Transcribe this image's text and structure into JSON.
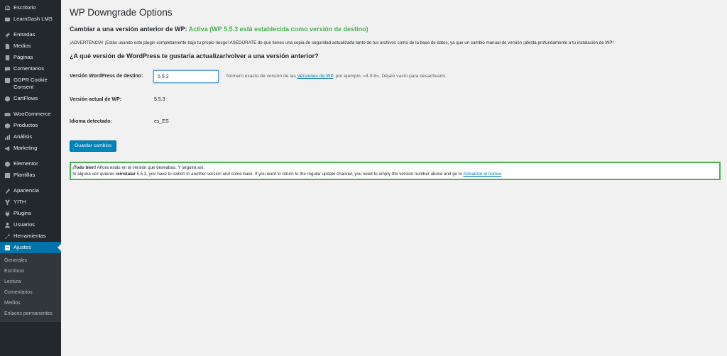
{
  "sidebar": {
    "items": [
      {
        "label": "Escritorio",
        "icon": "dashboard-icon"
      },
      {
        "label": "LearnDash LMS",
        "icon": "learndash-icon"
      },
      {
        "label": "Entradas",
        "icon": "pin-icon"
      },
      {
        "label": "Medios",
        "icon": "media-icon"
      },
      {
        "label": "Páginas",
        "icon": "page-icon"
      },
      {
        "label": "Comentarios",
        "icon": "comment-icon"
      },
      {
        "label": "GDPR Cookie Consent",
        "icon": "gdpr-icon"
      },
      {
        "label": "CartFlows",
        "icon": "cartflows-icon"
      },
      {
        "label": "WooCommerce",
        "icon": "woocommerce-icon"
      },
      {
        "label": "Productos",
        "icon": "products-icon"
      },
      {
        "label": "Análisis",
        "icon": "analytics-icon"
      },
      {
        "label": "Marketing",
        "icon": "marketing-icon"
      },
      {
        "label": "Elementor",
        "icon": "elementor-icon"
      },
      {
        "label": "Plantillas",
        "icon": "templates-icon"
      },
      {
        "label": "Apariencia",
        "icon": "appearance-icon"
      },
      {
        "label": "YITH",
        "icon": "yith-icon"
      },
      {
        "label": "Plugins",
        "icon": "plugins-icon"
      },
      {
        "label": "Usuarios",
        "icon": "users-icon"
      },
      {
        "label": "Herramientas",
        "icon": "tools-icon"
      },
      {
        "label": "Ajustes",
        "icon": "settings-icon"
      }
    ],
    "submenu": [
      "Generales",
      "Escritura",
      "Lectura",
      "Comentarios",
      "Medios",
      "Enlaces permanentes"
    ]
  },
  "main": {
    "title": "WP Downgrade Options",
    "subhead_prefix": "Cambiar a una versión anterior de WP: ",
    "subhead_status": "Activa (WP 5.5.3 está establecida como versión de destino)",
    "warning": "¡ADVERTENCIA! ¡Estás usando este plugin completamente bajo tu propio riesgo! ASEGÚRATE de que tienes una copia de seguridad actualizada tanto de tus archivos como de la base de datos, ya que un cambio manual de versión ¡afecta profundamente a tu instalación de WP!",
    "question": "¿A qué versión de WordPress te gustaría actualizar/volver a una versión anterior?",
    "target_label": "Versión WordPress de destino:",
    "target_value": "5.5.3",
    "help_prefix": "Número exacto de versión de las ",
    "help_link": "Versiones de WP",
    "help_suffix": ", por ejemplo, «4.9.8». Déjalo vacío para desactivarlo.",
    "current_label": "Versión actual de WP:",
    "current_value": "5.5.3",
    "lang_label": "Idioma detectado:",
    "lang_value": "es_ES",
    "save_button": "Guardar cambios",
    "notice_bold": "¡Todo bien!",
    "notice_line1": " Ahora estás en la versión que deseabas. Y seguirá así.",
    "notice_line2_prefix": "Si alguna vez quieres ",
    "notice_line2_bold": "reinstalar",
    "notice_line2_mid": " 5.5.3, you have to switch to another version and come back. If you want to return to the regular update channel, you need to empty the version number above and go to ",
    "notice_link": "Actualizar el núcleo",
    "notice_end": "."
  },
  "colors": {
    "sidebar_bg": "#23282d",
    "active": "#0073aa",
    "success": "#46b450",
    "link": "#0073aa"
  }
}
